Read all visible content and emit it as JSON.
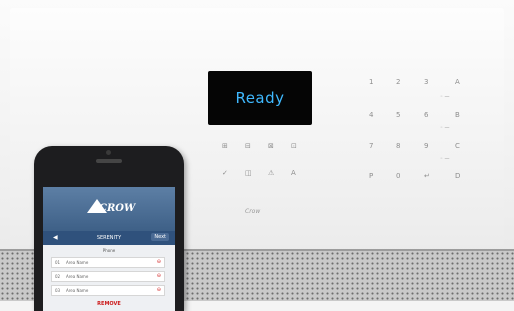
{
  "display": {
    "text": "Ready",
    "text_color": "#3fb9ff"
  },
  "function_keys": {
    "row1": [
      "⊞",
      "⊟",
      "⊠",
      "⊡"
    ],
    "row2": [
      "✓",
      "◫",
      "⚠",
      "A"
    ]
  },
  "keypad": {
    "digits": [
      "1",
      "2",
      "3",
      "4",
      "5",
      "6",
      "7",
      "8",
      "9",
      "P",
      "0",
      "↵"
    ],
    "letters": [
      "A",
      "B",
      "C",
      "D"
    ],
    "small_icons": [
      "◦ —",
      "◦ —",
      "◦ —",
      "◦ —"
    ]
  },
  "brand_mark": "Crow",
  "phone": {
    "app_logo": "CROW",
    "nav_back": "◀",
    "nav_title": "SERENITY",
    "nav_right": "Next",
    "section_label": "Phone",
    "rows": [
      {
        "num": "01",
        "label": "Area Name"
      },
      {
        "num": "02",
        "label": "Area Name"
      },
      {
        "num": "03",
        "label": "Area Name"
      }
    ],
    "action_label": "REMOVE"
  }
}
